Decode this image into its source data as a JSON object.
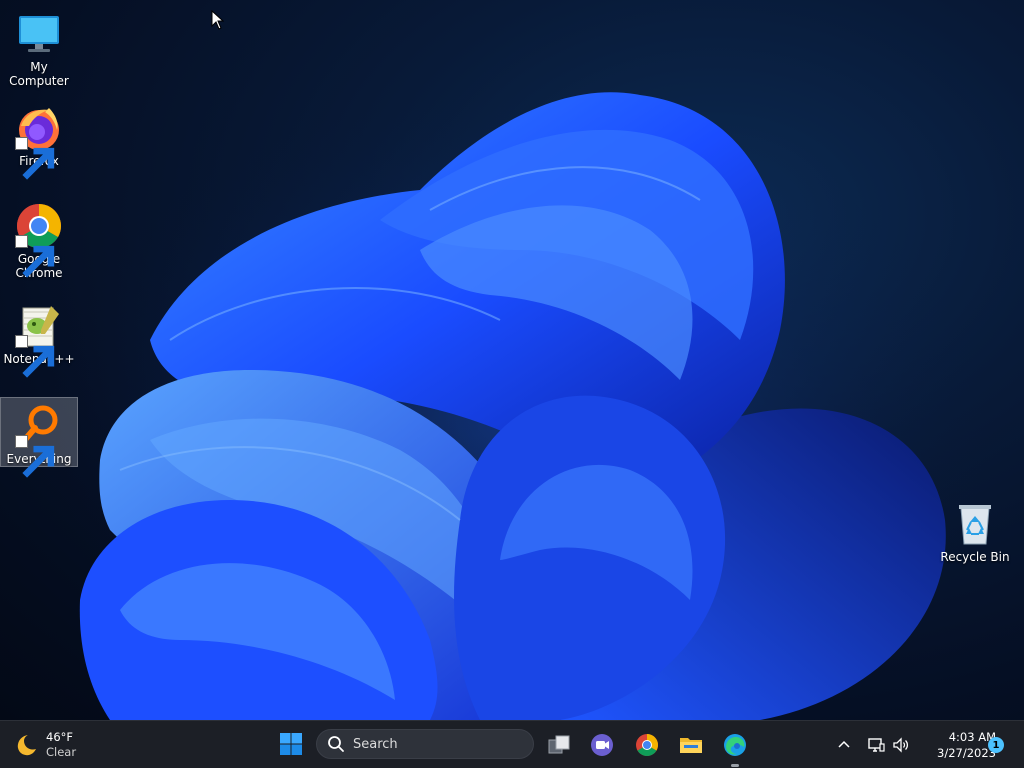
{
  "desktop": {
    "icons": [
      {
        "id": "my-computer",
        "label": "My Computer",
        "shortcut": false
      },
      {
        "id": "firefox",
        "label": "Firefox",
        "shortcut": true
      },
      {
        "id": "chrome",
        "label": "Google Chrome",
        "shortcut": true
      },
      {
        "id": "notepad",
        "label": "Notepad++",
        "shortcut": true
      },
      {
        "id": "everything",
        "label": "Everything",
        "shortcut": true,
        "selected": true
      },
      {
        "id": "recycle",
        "label": "Recycle Bin",
        "shortcut": false
      }
    ]
  },
  "taskbar": {
    "weather": {
      "temp": "46°F",
      "condition": "Clear",
      "icon": "moon-icon"
    },
    "search": {
      "placeholder": "Search"
    },
    "pinned": [
      {
        "name": "task-view",
        "icon": "task-view-icon"
      },
      {
        "name": "meet",
        "icon": "camera-icon"
      },
      {
        "name": "chrome",
        "icon": "chrome-icon"
      },
      {
        "name": "file-explorer",
        "icon": "folder-icon"
      },
      {
        "name": "edge",
        "icon": "edge-icon",
        "active": true
      }
    ],
    "tray": {
      "time": "4:03 AM",
      "date": "3/27/2023",
      "notifications": "1"
    }
  },
  "colors": {
    "accent": "#4cc2ff",
    "taskbar_bg": "#1c1f26",
    "wallpaper_blue": "#1a4cff"
  }
}
